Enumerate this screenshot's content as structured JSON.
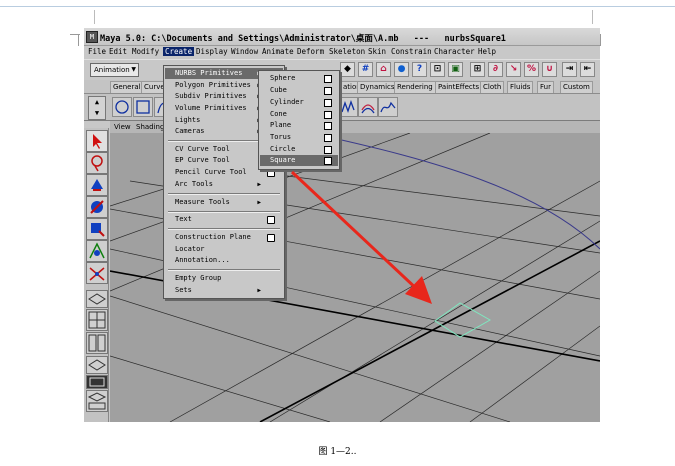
{
  "window": {
    "title": "Maya 5.0: C:\\Documents and Settings\\Administrator\\桌面\\A.mb   ---   nurbsSquare1"
  },
  "menubar": {
    "items": [
      "File",
      "Edit",
      "Modify",
      "Create",
      "Display",
      "Window",
      "Animate",
      "Deform",
      "Skeleton",
      "Skin",
      "Constrain",
      "Character",
      "Help"
    ],
    "active": "Create"
  },
  "statusline": {
    "mode": "Animation"
  },
  "shelf": {
    "tabs": [
      "General",
      "Curve",
      "ation",
      "Dynamics",
      "Rendering",
      "PaintEffects",
      "Cloth",
      "Fluids",
      "Fur",
      "Custom"
    ]
  },
  "panel": {
    "menus": [
      "View",
      "Shading"
    ]
  },
  "create_menu": {
    "items": [
      {
        "label": "NURBS Primitives",
        "submenu": true,
        "highlighted": true
      },
      {
        "label": "Polygon Primitives",
        "submenu": true
      },
      {
        "label": "Subdiv Primitives",
        "submenu": true
      },
      {
        "label": "Volume Primitives",
        "submenu": true
      },
      {
        "label": "Lights",
        "submenu": true
      },
      {
        "label": "Cameras",
        "submenu": true
      },
      {
        "label": "CV Curve Tool",
        "option": true
      },
      {
        "label": "EP Curve Tool",
        "option": true
      },
      {
        "label": "Pencil Curve Tool",
        "option": true
      },
      {
        "label": "Arc Tools",
        "submenu": true
      },
      {
        "label": "Measure Tools",
        "submenu": true
      },
      {
        "label": "Text",
        "option": true
      },
      {
        "label": "Construction Plane",
        "option": true
      },
      {
        "label": "Locator"
      },
      {
        "label": "Annotation..."
      },
      {
        "label": "Empty Group"
      },
      {
        "label": "Sets",
        "submenu": true
      }
    ]
  },
  "nurbs_submenu": {
    "items": [
      "Sphere",
      "Cube",
      "Cylinder",
      "Cone",
      "Plane",
      "Torus",
      "Circle",
      "Square"
    ],
    "highlighted": "Square"
  },
  "caption": "图 1—2..",
  "colors": {
    "menu_highlight": "#6a6a6a",
    "arrow": "#e8271c",
    "square_curve": "#7fe8c0",
    "circle_curve": "#3a3a8a"
  }
}
